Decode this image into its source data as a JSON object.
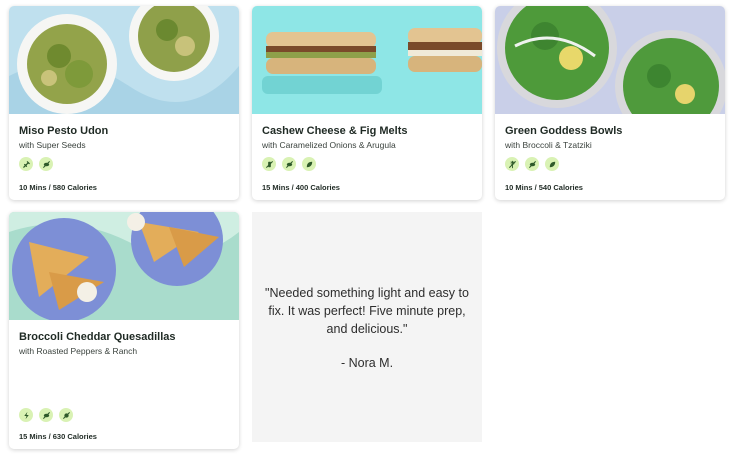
{
  "recipes": [
    {
      "title": "Miso Pesto Udon",
      "subtitle": "with Super Seeds",
      "tags": [
        "kitchen-tool-icon",
        "no-meat-icon"
      ],
      "meta": "10 Mins / 580 Calories"
    },
    {
      "title": "Cashew Cheese & Fig Melts",
      "subtitle": "with Caramelized Onions & Arugula",
      "tags": [
        "no-dairy-icon",
        "no-meat-icon",
        "leaf-icon"
      ],
      "meta": "15 Mins / 400 Calories"
    },
    {
      "title": "Green Goddess Bowls",
      "subtitle": "with Broccoli & Tzatziki",
      "tags": [
        "no-gluten-icon",
        "no-meat-icon",
        "leaf-icon"
      ],
      "meta": "10 Mins / 540 Calories"
    },
    {
      "title": "Broccoli Cheddar Quesadillas",
      "subtitle": "with Roasted Peppers & Ranch",
      "tags": [
        "quick-icon",
        "no-meat-icon",
        "no-nuts-icon"
      ],
      "meta": "15 Mins / 630 Calories"
    }
  ],
  "testimonial": {
    "quote": "\"Needed something light and easy to fix. It was perfect! Five minute prep, and delicious.\"",
    "author": "- Nora M."
  },
  "colors": {
    "tag_bg": "#d9f2b4",
    "tag_icon": "#2f5a2a",
    "quote_bg": "#f4f4f4"
  }
}
